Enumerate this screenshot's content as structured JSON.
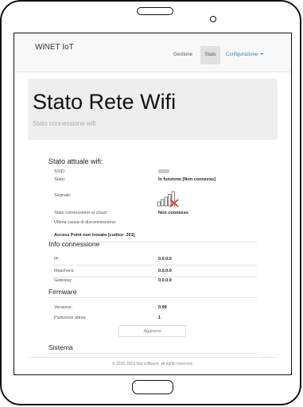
{
  "navbar": {
    "brand": "WiNET IoT",
    "items": [
      {
        "label": "Gestione",
        "active": false
      },
      {
        "label": "Stato",
        "active": true
      },
      {
        "label": "Configurazione",
        "dropdown": true
      }
    ]
  },
  "header": {
    "title": "Stato Rete Wifi",
    "subtitle": "Stato connessione wifi"
  },
  "wifi_status": {
    "title": "Stato attuale wifi:",
    "rows": [
      {
        "label": "SSID:",
        "value": ""
      },
      {
        "label": "Stato:",
        "value": "In funzione [Non connesso]"
      },
      {
        "label": "Segnale:",
        "value": ""
      },
      {
        "label": "Stato connessione al cloud:",
        "value": "Non connesso"
      },
      {
        "label": "Ultima causa di disconnessione:",
        "value": ""
      }
    ],
    "disconnect_reason": "Access Point non trovato [codice: 201]",
    "signal_icon": "wifi-signal-no-connection-icon"
  },
  "connection_info": {
    "title": "Info connessione",
    "rows": [
      {
        "label": "IP:",
        "value": "0.0.0.0"
      },
      {
        "label": "Maschera:",
        "value": "0.0.0.0"
      },
      {
        "label": "Gateway:",
        "value": "0.0.0.0"
      }
    ]
  },
  "firmware": {
    "title": "Firmware",
    "rows": [
      {
        "label": "Versione:",
        "value": "0.99"
      },
      {
        "label": "Partizione attiva:",
        "value": "1"
      }
    ],
    "update_label": "Aggiorna"
  },
  "system": {
    "title": "Sistema"
  },
  "footer": {
    "text": "© 2016-2019 Nat software, all rights reserved."
  },
  "colors": {
    "link": "#337ab7",
    "navbar_bg": "#f8f8f8",
    "active_tab_bg": "#e0e0e0",
    "jumbotron_bg": "#eeeeee",
    "error_red": "#e0302a"
  }
}
